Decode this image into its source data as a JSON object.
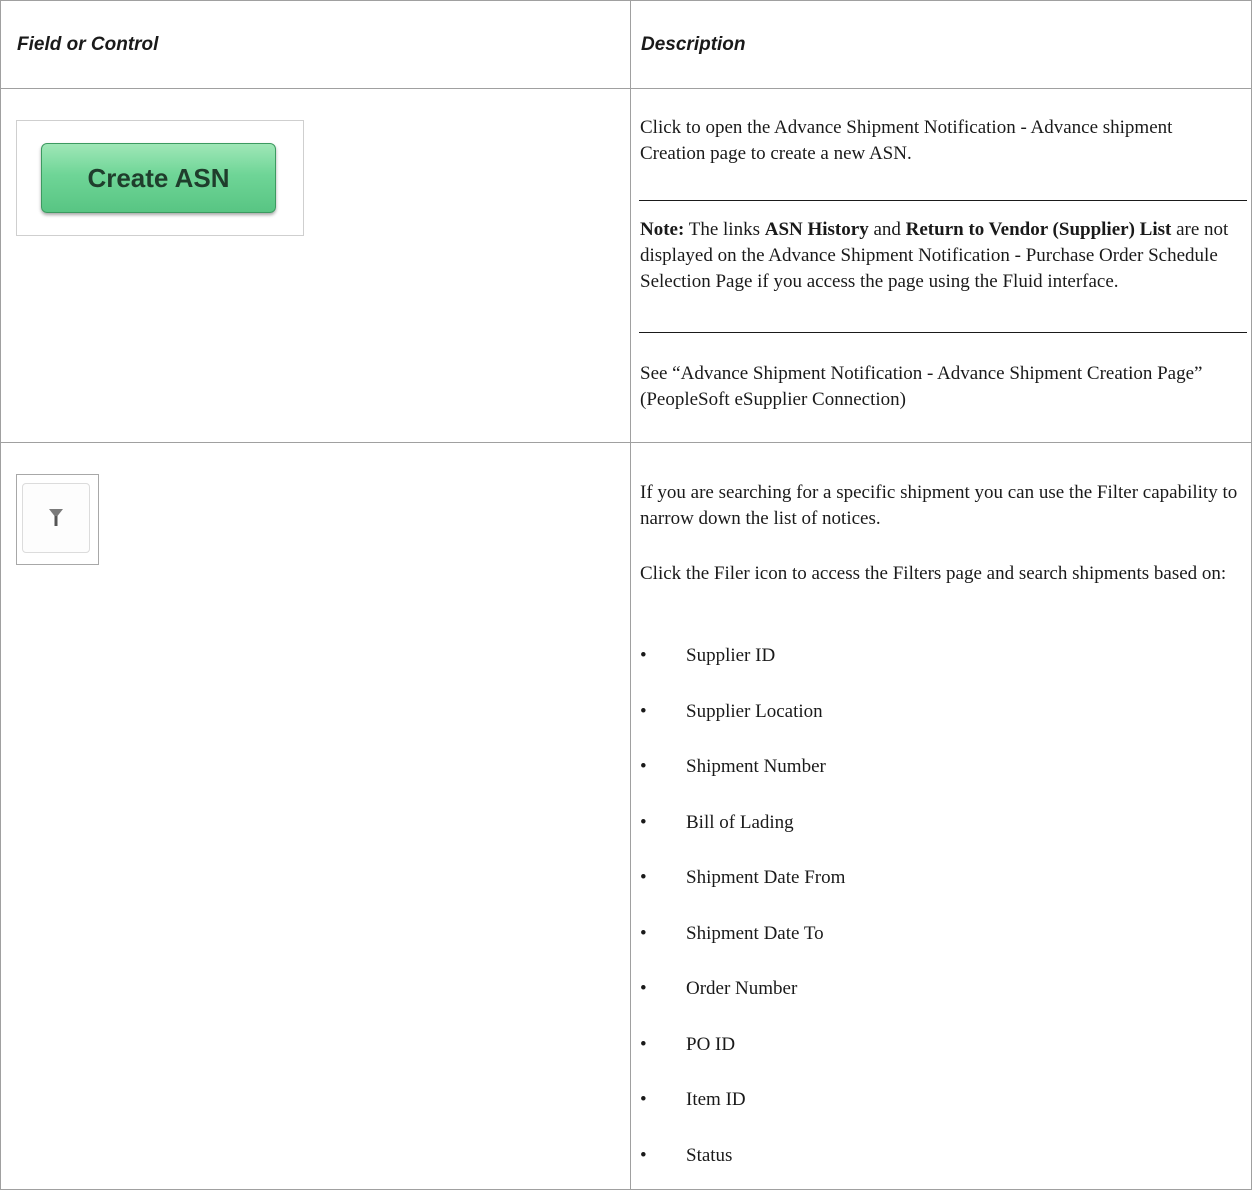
{
  "table": {
    "headers": [
      "Field or Control",
      "Description"
    ]
  },
  "row1": {
    "button_label": "Create ASN",
    "description": "Click to open the Advance Shipment Notification - Advance shipment Creation page to create a new ASN.",
    "note_label": "Note:",
    "note_text_1": " The links ",
    "note_link_1": "ASN History",
    "note_text_2": " and ",
    "note_link_2": "Return to Vendor (Supplier) List",
    "note_text_3": " are not displayed on the Advance Shipment Notification - Purchase Order Schedule Selection Page if you access the page using the Fluid interface.",
    "see_also": "See “Advance Shipment Notification - Advance Shipment Creation Page” (PeopleSoft eSupplier Connection)"
  },
  "row2": {
    "icon": "filter-icon",
    "para1": "If you are searching for a specific shipment you can use the Filter capability to narrow down the list of notices.",
    "para2": "Click the Filer icon to access the Filters page and search shipments based on:",
    "bullet_char": "•",
    "bullets": [
      "Supplier ID",
      "Supplier Location",
      "Shipment Number",
      "Bill of Lading",
      "Shipment Date From",
      "Shipment Date To",
      "Order Number",
      "PO ID",
      "Item ID",
      "Status"
    ]
  },
  "colors": {
    "button_green": "#6fd597",
    "border": "#a0a0a0",
    "text": "#1a1a1a"
  }
}
